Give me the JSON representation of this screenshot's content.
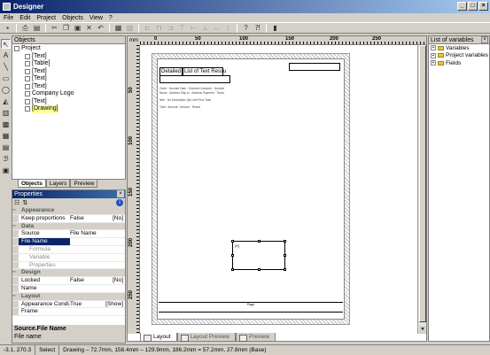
{
  "window": {
    "title": "Designer",
    "controls": [
      "_",
      "□",
      "×"
    ]
  },
  "menu": [
    "File",
    "Edit",
    "Project",
    "Objects",
    "View",
    "?"
  ],
  "toolbar_icons": [
    "save-icon",
    "print-icon",
    "print-preview-icon",
    "cut-icon",
    "copy-icon",
    "paste-icon",
    "delete-icon",
    "undo-icon",
    "copy-format-icon",
    "paste-format-icon",
    "align-left-icon",
    "align-center-icon",
    "align-right-icon",
    "align-top-icon",
    "align-middle-icon",
    "align-bottom-icon",
    "same-width-icon",
    "same-height-icon",
    "help-icon",
    "context-help-icon",
    "bookmark-icon"
  ],
  "objects_panel": {
    "title": "Objects",
    "root": "Project",
    "items": [
      "[Text]",
      "[Table]",
      "[Text]",
      "[Text]",
      "[Text]",
      "Company Logo",
      "[Text]",
      "[Drawing]"
    ],
    "selected_index": 7
  },
  "left_tabs": [
    "Objects",
    "Layers",
    "Preview"
  ],
  "properties": {
    "title": "Properties",
    "rows": [
      {
        "type": "cat",
        "k": "Appearance"
      },
      {
        "type": "row",
        "k": "Keep proportions",
        "v": "False",
        "o": "[No]"
      },
      {
        "type": "cat",
        "k": "Data"
      },
      {
        "type": "row",
        "k": "Source",
        "v": "File Name",
        "o": ""
      },
      {
        "type": "sel",
        "k": "File Name",
        "v": "",
        "o": ""
      },
      {
        "type": "sub",
        "k": "Formula",
        "v": "",
        "o": ""
      },
      {
        "type": "sub",
        "k": "Variable",
        "v": "",
        "o": ""
      },
      {
        "type": "sub",
        "k": "Properties",
        "v": "",
        "o": ""
      },
      {
        "type": "cat",
        "k": "Design"
      },
      {
        "type": "row",
        "k": "Locked",
        "v": "False",
        "o": "[No]"
      },
      {
        "type": "row",
        "k": "Name",
        "v": "",
        "o": ""
      },
      {
        "type": "cat",
        "k": "Layout"
      },
      {
        "type": "row",
        "k": "Appearance Condi...",
        "v": "True",
        "o": "[Show]"
      },
      {
        "type": "row",
        "k": "Frame",
        "v": "",
        "o": ""
      }
    ],
    "desc_title": "Source.File Name",
    "desc_text": "File name"
  },
  "rulers": {
    "unit": "mm",
    "top": [
      "0",
      "50",
      "100",
      "150",
      "200",
      "250"
    ],
    "left": [
      "50",
      "100",
      "150",
      "200",
      "250"
    ]
  },
  "page": {
    "field_1": "Detailed",
    "field_2": "List of Text Ressu",
    "drawing_label": "[X]",
    "lines": [
      "Order · Number     Date · Ordered     Customer · Number",
      "Name · Address     Ship to · Address     Payment · Terms",
      "Item · No    Description    Qty    Unit Price    Total",
      "Total · Amount · Amount · Result"
    ],
    "footer": "Page"
  },
  "view_tabs": [
    "Layout",
    "Layout Preview",
    "Preview"
  ],
  "variables_panel": {
    "title": "List of variables",
    "items": [
      "Variables",
      "Project variables",
      "Fields"
    ]
  },
  "status": {
    "coords": "-3.1, 270.3",
    "mode": "Select",
    "info": "Drawing – 72.7mm, 158.4mm – 129.9mm, 186.2mm = 57.2mm, 27.8mm (Base)"
  }
}
